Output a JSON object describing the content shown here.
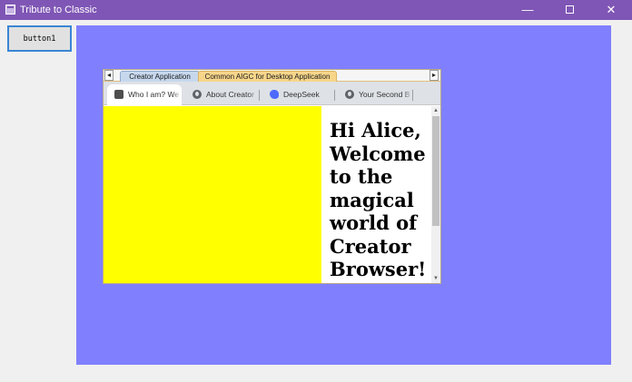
{
  "window": {
    "title": "Tribute to Classic",
    "minimize_glyph": "—",
    "close_glyph": "✕"
  },
  "form": {
    "button1_label": "button1",
    "panel_color": "#8080ff"
  },
  "browser": {
    "scroll_left_glyph": "◂",
    "scroll_right_glyph": "▸",
    "tab_groups": [
      {
        "label": "Creator Application",
        "color": "#c7d8ee"
      },
      {
        "label": "Common AIGC for Desktop Application",
        "color": "#f7d58a"
      }
    ],
    "tabs": [
      {
        "label": "Who I am? Welcome",
        "icon": "document-icon",
        "active": true
      },
      {
        "label": "About Creator",
        "icon": "globe-icon",
        "active": false
      },
      {
        "label": "DeepSeek",
        "icon": "deepseek-whale-icon",
        "active": false
      },
      {
        "label": "Your Second Brain",
        "icon": "globe-icon",
        "active": false
      }
    ],
    "page": {
      "greeting": "Hi Alice, Welcome to the magical world of Creator Browser!",
      "box_color": "#ffff00"
    },
    "scrollbar": {
      "up_glyph": "▲",
      "down_glyph": "▼"
    }
  }
}
